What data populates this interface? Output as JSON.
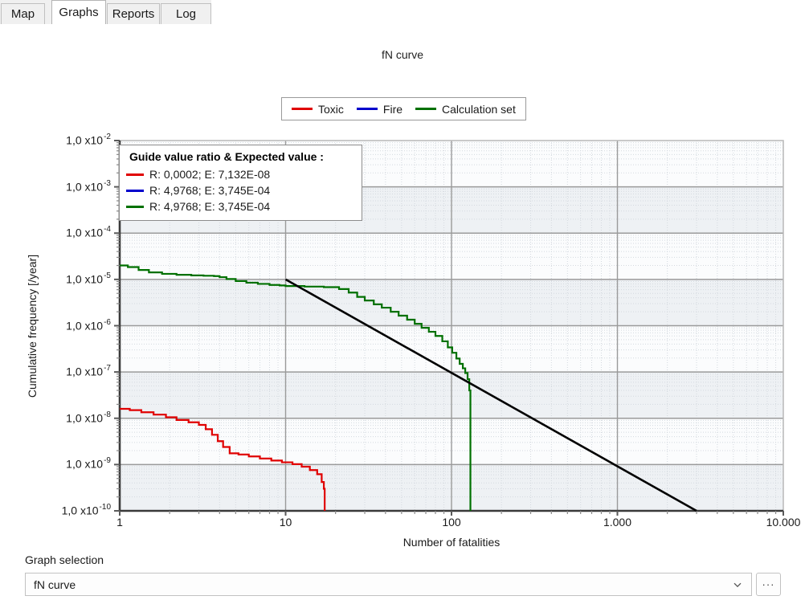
{
  "tabs": [
    {
      "label": "Map",
      "selected": false
    },
    {
      "label": "Graphs",
      "selected": true
    },
    {
      "label": "Reports",
      "selected": false
    },
    {
      "label": "Log",
      "selected": false
    }
  ],
  "chart_title": "fN curve",
  "series_legend": [
    {
      "label": "Toxic",
      "color": "#e00000"
    },
    {
      "label": "Fire",
      "color": "#0000cc"
    },
    {
      "label": "Calculation set",
      "color": "#007000"
    }
  ],
  "infobox": {
    "title": "Guide value ratio & Expected value :",
    "rows": [
      {
        "color": "#e00000",
        "text": "R: 0,0002; E: 7,132E-08"
      },
      {
        "color": "#0000cc",
        "text": "R: 4,9768; E: 3,745E-04"
      },
      {
        "color": "#007000",
        "text": "R: 4,9768; E: 3,745E-04"
      }
    ]
  },
  "bottom": {
    "graph_selection_label": "Graph selection",
    "graph_selection_value": "fN curve",
    "dots_button_label": "···"
  },
  "chart_data": {
    "type": "line",
    "title": "fN curve",
    "xlabel": "Number of fatalities",
    "ylabel": "Cumulative frequency [/year]",
    "xscale": "log",
    "yscale": "log",
    "xlim": [
      1,
      10000
    ],
    "ylim": [
      1e-10,
      0.01
    ],
    "grid": true,
    "legend_position": "top-center",
    "xtick_labels": [
      "1",
      "10",
      "100",
      "1.000",
      "10.000"
    ],
    "xtick_values": [
      1,
      10,
      100,
      1000,
      10000
    ],
    "ytick_labels": [
      {
        "mantissa": "1,0 x10",
        "exponent": "-2"
      },
      {
        "mantissa": "1,0 x10",
        "exponent": "-3"
      },
      {
        "mantissa": "1,0 x10",
        "exponent": "-4"
      },
      {
        "mantissa": "1,0 x10",
        "exponent": "-5"
      },
      {
        "mantissa": "1,0 x10",
        "exponent": "-6"
      },
      {
        "mantissa": "1,0 x10",
        "exponent": "-7"
      },
      {
        "mantissa": "1,0 x10",
        "exponent": "-8"
      },
      {
        "mantissa": "1,0 x10",
        "exponent": "-9"
      },
      {
        "mantissa": "1,0 x10",
        "exponent": "-10"
      }
    ],
    "ytick_values": [
      0.01,
      0.001,
      0.0001,
      1e-05,
      1e-06,
      1e-07,
      1e-08,
      1e-09,
      1e-10
    ],
    "series": [
      {
        "name": "Toxic",
        "color": "#e00000",
        "step": true,
        "points": [
          [
            1,
            1.6e-08
          ],
          [
            1.15,
            1.5e-08
          ],
          [
            1.35,
            1.35e-08
          ],
          [
            1.6,
            1.2e-08
          ],
          [
            1.9,
            1.05e-08
          ],
          [
            2.2,
            9.2e-09
          ],
          [
            2.6,
            8.2e-09
          ],
          [
            3.0,
            7.2e-09
          ],
          [
            3.3,
            5.8e-09
          ],
          [
            3.6,
            4.4e-09
          ],
          [
            3.9,
            3.2e-09
          ],
          [
            4.2,
            2.4e-09
          ],
          [
            4.6,
            1.75e-09
          ],
          [
            5.2,
            1.65e-09
          ],
          [
            6.0,
            1.5e-09
          ],
          [
            7.0,
            1.35e-09
          ],
          [
            8.2,
            1.22e-09
          ],
          [
            9.5,
            1.12e-09
          ],
          [
            11,
            1.02e-09
          ],
          [
            12.5,
            9e-10
          ],
          [
            14,
            7.6e-10
          ],
          [
            15.5,
            6.2e-10
          ],
          [
            16.5,
            4.2e-10
          ],
          [
            17,
            3e-10
          ],
          [
            17.2,
            1e-10
          ]
        ]
      },
      {
        "name": "Fire",
        "color": "#0000cc",
        "step": true,
        "points": []
      },
      {
        "name": "Calculation set",
        "color": "#007000",
        "step": true,
        "points": [
          [
            1,
            2e-05
          ],
          [
            1.12,
            1.85e-05
          ],
          [
            1.3,
            1.6e-05
          ],
          [
            1.5,
            1.42e-05
          ],
          [
            1.8,
            1.32e-05
          ],
          [
            2.2,
            1.26e-05
          ],
          [
            2.7,
            1.22e-05
          ],
          [
            3.2,
            1.2e-05
          ],
          [
            3.7,
            1.18e-05
          ],
          [
            4.0,
            1.12e-05
          ],
          [
            4.4,
            1.02e-05
          ],
          [
            5.0,
            9.2e-06
          ],
          [
            5.8,
            8.5e-06
          ],
          [
            6.8,
            8e-06
          ],
          [
            8.0,
            7.6e-06
          ],
          [
            9.2,
            7.4e-06
          ],
          [
            10,
            7.2e-06
          ],
          [
            13,
            7e-06
          ],
          [
            17,
            6.8e-06
          ],
          [
            21,
            6.2e-06
          ],
          [
            24,
            5.2e-06
          ],
          [
            27,
            4.2e-06
          ],
          [
            30,
            3.5e-06
          ],
          [
            34,
            2.9e-06
          ],
          [
            38,
            2.45e-06
          ],
          [
            43,
            2e-06
          ],
          [
            48,
            1.65e-06
          ],
          [
            54,
            1.35e-06
          ],
          [
            60,
            1.1e-06
          ],
          [
            66,
            9e-07
          ],
          [
            73,
            7.4e-07
          ],
          [
            80,
            6e-07
          ],
          [
            88,
            4.6e-07
          ],
          [
            95,
            3.4e-07
          ],
          [
            101,
            2.6e-07
          ],
          [
            107,
            1.95e-07
          ],
          [
            112,
            1.5e-07
          ],
          [
            117,
            1.2e-07
          ],
          [
            121,
            9.5e-08
          ],
          [
            125,
            7e-08
          ],
          [
            128,
            4e-08
          ],
          [
            130,
            1e-10
          ]
        ]
      },
      {
        "name": "Guide value line",
        "color": "#000000",
        "step": false,
        "points": [
          [
            10,
            1e-05
          ],
          [
            3000,
            1e-10
          ]
        ]
      }
    ]
  }
}
